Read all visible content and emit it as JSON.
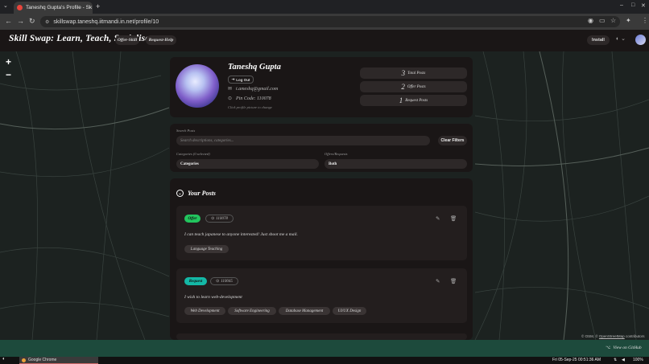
{
  "browser": {
    "tab_title": "Taneshq Gupta's Profile - Sk",
    "url": "skillswap.taneshq.iitmandi.in.net/profile/10"
  },
  "header": {
    "logo": "Skill Swap: Learn, Teach, Socialise",
    "offer_skill": "Offer-Skill",
    "request_help": "Request-Help",
    "install": "Install"
  },
  "map": {
    "zoom_in": "+",
    "zoom_out": "−",
    "attribution_osm": "© OSM",
    "attribution_sep": ", ©",
    "attribution_contrib": "OpenStreetMap",
    "attribution_tail": "contributors"
  },
  "profile": {
    "name": "Taneshq Gupta",
    "logout": "Log Out",
    "email": "t.ameshq@gmail.com",
    "pin_code": "Pin Code: 110078",
    "picture_hint": "Click profile picture to change",
    "stats": [
      {
        "value": "3",
        "label": "Total Posts"
      },
      {
        "value": "2",
        "label": "Offer Posts"
      },
      {
        "value": "1",
        "label": "Request Posts"
      }
    ]
  },
  "filters": {
    "search_label": "Search Posts",
    "search_placeholder": "Search descriptions, categories...",
    "clear": "Clear Filters",
    "categories_label": "Categories (0 selected)",
    "categories_value": "Categories",
    "type_label": "Offers/Requests",
    "type_value": "Both"
  },
  "posts": {
    "title": "Your Posts",
    "items": [
      {
        "type": "Offer",
        "type_color": "#22c55e",
        "pin": "110078",
        "description": "I can teach japanese to anyone interested! Just shoot me a mail.",
        "tags": [
          "Language Teaching"
        ]
      },
      {
        "type": "Request",
        "type_color": "#14b8a6",
        "pin": "110045",
        "description": "I wish to learn web-development",
        "tags": [
          "Web Development",
          "Software Engineering",
          "Database Management",
          "UI/UX Design"
        ]
      }
    ]
  },
  "footer": {
    "github": "View on GitHub"
  },
  "taskbar": {
    "app": "Google Chrome",
    "clock": "Fri 05-Sep-25 00:51:36 AM",
    "battery": "100%"
  }
}
